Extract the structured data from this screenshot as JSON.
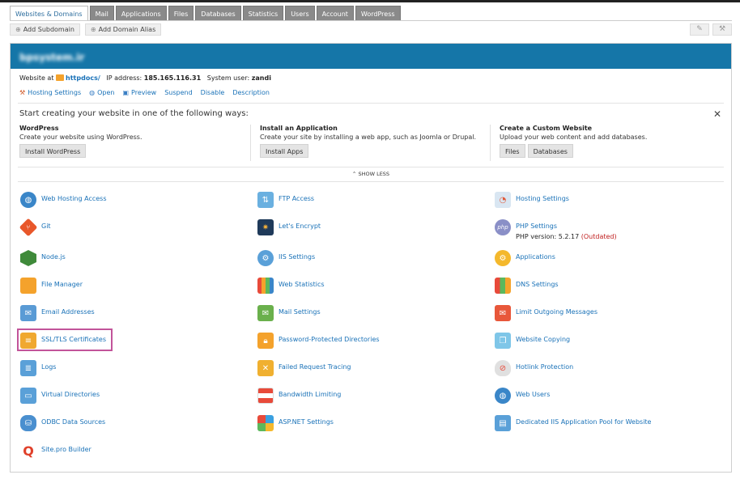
{
  "tabs": [
    "Websites & Domains",
    "Mail",
    "Applications",
    "Files",
    "Databases",
    "Statistics",
    "Users",
    "Account",
    "WordPress"
  ],
  "toolbar": {
    "add_subdomain": "Add Subdomain",
    "add_domain_alias": "Add Domain Alias"
  },
  "domain": {
    "name": "bpsystem.ir"
  },
  "info": {
    "website_at_label": "Website at",
    "httpdocs": "httpdocs/",
    "ip_label": "IP address:",
    "ip": "185.165.116.31",
    "sysuser_label": "System user:",
    "sysuser": "zandi"
  },
  "actions": [
    "Hosting Settings",
    "Open",
    "Preview",
    "Suspend",
    "Disable",
    "Description"
  ],
  "start": {
    "heading": "Start creating your website in one of the following ways:",
    "options": [
      {
        "title": "WordPress",
        "desc": "Create your website using WordPress.",
        "buttons": [
          "Install WordPress"
        ]
      },
      {
        "title": "Install an Application",
        "desc": "Create your site by installing a web app, such as Joomla or Drupal.",
        "buttons": [
          "Install Apps"
        ]
      },
      {
        "title": "Create a Custom Website",
        "desc": "Upload your web content and add databases.",
        "buttons": [
          "Files",
          "Databases"
        ]
      }
    ],
    "show_less": "SHOW LESS"
  },
  "tools": [
    [
      "Web Hosting Access",
      "Git",
      "Node.js",
      "File Manager",
      "Email Addresses",
      "SSL/TLS Certificates",
      "Logs",
      "Virtual Directories",
      "ODBC Data Sources",
      "Site.pro Builder"
    ],
    [
      "FTP Access",
      "Let's Encrypt",
      "IIS Settings",
      "Web Statistics",
      "Mail Settings",
      "Password-Protected Directories",
      "Failed Request Tracing",
      "Bandwidth Limiting",
      "ASP.NET Settings"
    ],
    [
      "Hosting Settings",
      "PHP Settings",
      "Applications",
      "DNS Settings",
      "Limit Outgoing Messages",
      "Website Copying",
      "Hotlink Protection",
      "Web Users",
      "Dedicated IIS Application Pool for Website"
    ]
  ],
  "php": {
    "prefix": "PHP version: 5.2.17",
    "outdated": "(Outdated)"
  },
  "colors": {
    "banner": "#1576a8",
    "link": "#1a72b8",
    "highlight": "#c2549a",
    "outdated": "#c02020"
  }
}
